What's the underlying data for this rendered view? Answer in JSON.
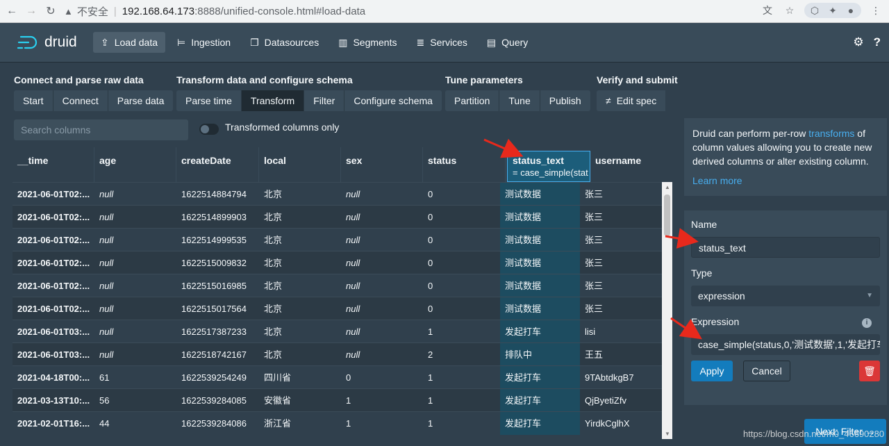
{
  "browser": {
    "insecure_label": "不安全",
    "host": "192.168.64.173",
    "path": ":8888/unified-console.html#load-data"
  },
  "header": {
    "logo": "druid",
    "nav": [
      {
        "label": "Load data",
        "icon": "cloud-upload-icon"
      },
      {
        "label": "Ingestion",
        "icon": "gantt-icon"
      },
      {
        "label": "Datasources",
        "icon": "multi-select-icon"
      },
      {
        "label": "Segments",
        "icon": "stacked-chart-icon"
      },
      {
        "label": "Services",
        "icon": "database-icon"
      },
      {
        "label": "Query",
        "icon": "application-icon"
      }
    ]
  },
  "steps": [
    {
      "title": "Connect and parse raw data",
      "buttons": [
        "Start",
        "Connect",
        "Parse data"
      ]
    },
    {
      "title": "Transform data and configure schema",
      "buttons": [
        "Parse time",
        "Transform",
        "Filter",
        "Configure schema"
      ]
    },
    {
      "title": "Tune parameters",
      "buttons": [
        "Partition",
        "Tune",
        "Publish"
      ]
    },
    {
      "title": "Verify and submit",
      "buttons": [
        "Edit spec"
      ]
    }
  ],
  "search": {
    "placeholder": "Search columns"
  },
  "toggle_label": "Transformed columns only",
  "table": {
    "columns": [
      "__time",
      "age",
      "createDate",
      "local",
      "sex",
      "status",
      "status_text",
      "username"
    ],
    "highlight_subtitle": "= case_simple(stat",
    "rows": [
      [
        "2021-06-01T02:...",
        "null",
        "1622514884794",
        "北京",
        "null",
        "0",
        "测试数据",
        "张三"
      ],
      [
        "2021-06-01T02:...",
        "null",
        "1622514899903",
        "北京",
        "null",
        "0",
        "测试数据",
        "张三"
      ],
      [
        "2021-06-01T02:...",
        "null",
        "1622514999535",
        "北京",
        "null",
        "0",
        "测试数据",
        "张三"
      ],
      [
        "2021-06-01T02:...",
        "null",
        "1622515009832",
        "北京",
        "null",
        "0",
        "测试数据",
        "张三"
      ],
      [
        "2021-06-01T02:...",
        "null",
        "1622515016985",
        "北京",
        "null",
        "0",
        "测试数据",
        "张三"
      ],
      [
        "2021-06-01T02:...",
        "null",
        "1622515017564",
        "北京",
        "null",
        "0",
        "测试数据",
        "张三"
      ],
      [
        "2021-06-01T03:...",
        "null",
        "1622517387233",
        "北京",
        "null",
        "1",
        "发起打车",
        "lisi"
      ],
      [
        "2021-06-01T03:...",
        "null",
        "1622518742167",
        "北京",
        "null",
        "2",
        "排队中",
        "王五"
      ],
      [
        "2021-04-18T00:...",
        "61",
        "1622539254249",
        "四川省",
        "0",
        "1",
        "发起打车",
        "9TAbtdkgB7"
      ],
      [
        "2021-03-13T10:...",
        "56",
        "1622539284085",
        "安徽省",
        "1",
        "1",
        "发起打车",
        "QjByetiZfv"
      ],
      [
        "2021-02-01T16:...",
        "44",
        "1622539284086",
        "浙江省",
        "1",
        "1",
        "发起打车",
        "YirdkCglhX"
      ]
    ]
  },
  "info": {
    "text_before": "Druid can perform per-row ",
    "link": "transforms",
    "text_after": " of column values allowing you to create new derived columns or alter existing column.",
    "learn_more": "Learn more"
  },
  "form": {
    "name_label": "Name",
    "name_value": "status_text",
    "type_label": "Type",
    "type_value": "expression",
    "expression_label": "Expression",
    "expression_value": "case_simple(status,0,'测试数据',1,'发起打车",
    "apply": "Apply",
    "cancel": "Cancel"
  },
  "next_button": "Next: Filter",
  "watermark": "https://blog.csdn.net/m0_46690280",
  "colors": {
    "accent": "#137cbd",
    "danger": "#db3737",
    "highlight_border": "#48aff0"
  }
}
